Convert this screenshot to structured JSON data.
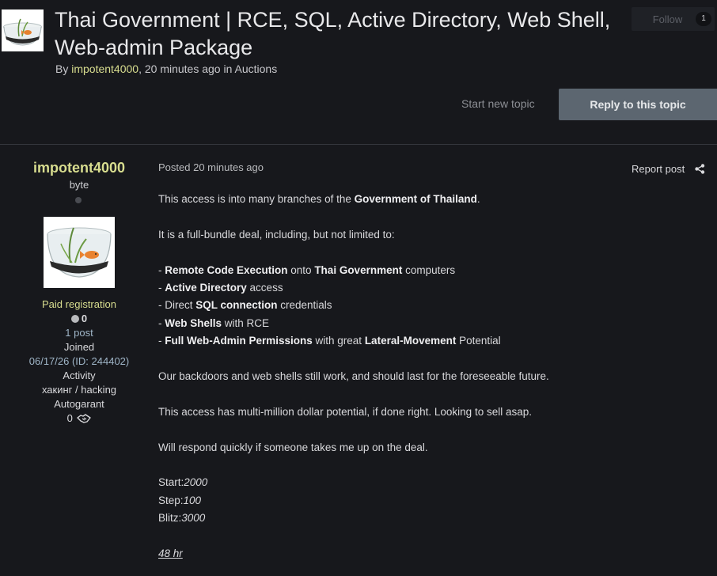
{
  "topic": {
    "title": "Thai Government | RCE, SQL, Active Directory, Web Shell, Web-admin Package",
    "by_label": "By",
    "author": "impotent4000",
    "time_sep": ", ",
    "time": "20 minutes ago",
    "in_label": " in ",
    "forum": "Auctions"
  },
  "follow": {
    "label": "Follow",
    "count": "1"
  },
  "actions": {
    "start_topic": "Start new topic",
    "reply": "Reply to this topic"
  },
  "author_panel": {
    "name": "impotent4000",
    "rank": "byte",
    "group": "Paid registration",
    "reputation": "0",
    "posts": "1 post",
    "joined_label": "Joined",
    "joined_value": "06/17/26 (ID: 244402)",
    "activity_label": "Activity",
    "activity_value": "хакинг / hacking",
    "autogarant_label": "Autogarant",
    "autogarant_value": "0"
  },
  "post": {
    "posted_label": "Posted",
    "posted_time": "20 minutes ago",
    "report": "Report post",
    "line1_a": "This access is into many branches of the ",
    "line1_b": "Government of Thailand",
    "line1_c": ".",
    "line2": "It is a full-bundle deal, including, but not limited to:",
    "b1_a": "- ",
    "b1_b": "Remote Code Execution",
    "b1_c": " onto ",
    "b1_d": "Thai Government",
    "b1_e": " computers",
    "b2_a": "- ",
    "b2_b": "Active Directory",
    "b2_c": " access",
    "b3_a": "- Direct ",
    "b3_b": "SQL connection",
    "b3_c": " credentials",
    "b4_a": "- ",
    "b4_b": "Web Shells",
    "b4_c": " with RCE",
    "b5_a": "- ",
    "b5_b": "Full Web-Admin Permissions",
    "b5_c": " with great ",
    "b5_d": "Lateral-Movement",
    "b5_e": " Potential",
    "line3": "Our backdoors and web shells still work, and should last for the foreseeable future.",
    "line4": "This access has multi-million dollar potential, if done right. Looking to sell asap.",
    "line5": "Will respond quickly if someone takes me up on the deal.",
    "start_label": "Start:",
    "start_value": "2000",
    "step_label": "Step:",
    "step_value": "100",
    "blitz_label": "Blitz:",
    "blitz_value": "3000",
    "duration": "48 hr"
  },
  "icons": {
    "topic_avatar": "fishbowl-image",
    "author_avatar": "fishbowl-image",
    "share": "share-icon",
    "online": "offline-dot",
    "autogarant": "handshake-icon"
  },
  "colors": {
    "background": "#17181c",
    "author_accent": "#d8dd8f",
    "reply_button": "#5c6670",
    "link_blue": "#9fb5c7"
  }
}
